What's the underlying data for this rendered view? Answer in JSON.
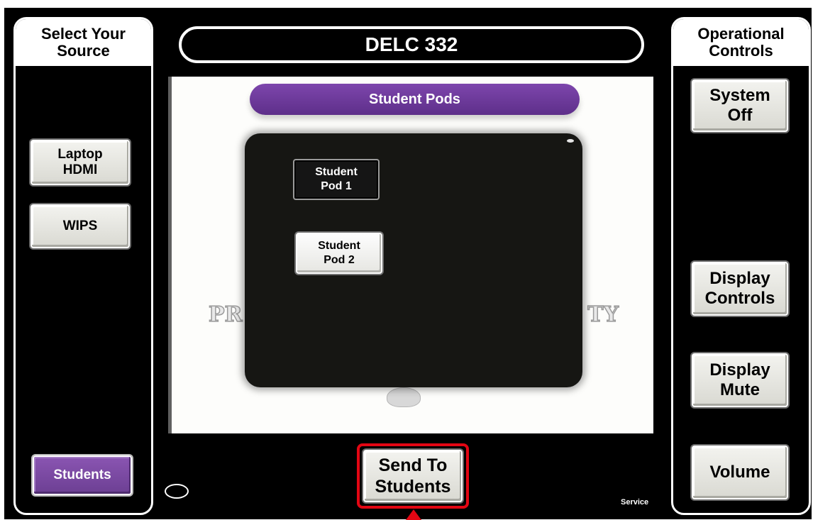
{
  "source_panel": {
    "title": "Select Your\nSource",
    "buttons": [
      {
        "label": "Laptop\nHDMI"
      },
      {
        "label": "WIPS"
      },
      {
        "label": "Students"
      }
    ]
  },
  "header": {
    "title": "DELC 332"
  },
  "main": {
    "banner": "Student Pods",
    "watermark_left": "PR",
    "watermark_right": "TY",
    "pods": [
      {
        "label": "Student\nPod 1"
      },
      {
        "label": "Student\nPod 2"
      }
    ],
    "send_label": "Send To\nStudents",
    "service_label": "Service"
  },
  "operational_panel": {
    "title": "Operational\nControls",
    "buttons": [
      {
        "label": "System\nOff"
      },
      {
        "label": "Display\nControls"
      },
      {
        "label": "Display\nMute"
      },
      {
        "label": "Volume"
      }
    ]
  },
  "colors": {
    "accent_purple": "#6c3f93",
    "highlight_red": "#e30613",
    "panel_black": "#000000"
  }
}
